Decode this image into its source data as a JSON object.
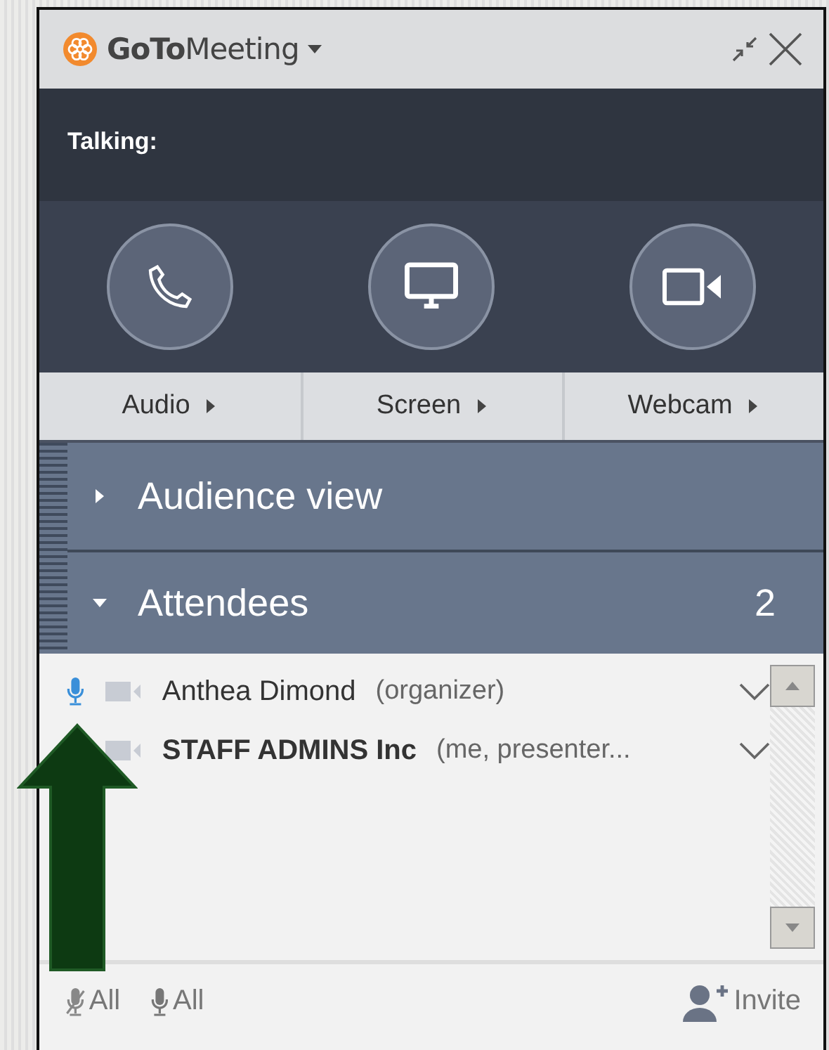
{
  "window": {
    "brand_bold": "GoTo",
    "brand_rest": "Meeting"
  },
  "talking": {
    "label": "Talking:"
  },
  "share_buttons": [
    {
      "kind": "audio",
      "label": "Audio"
    },
    {
      "kind": "screen",
      "label": "Screen"
    },
    {
      "kind": "webcam",
      "label": "Webcam"
    }
  ],
  "sections": [
    {
      "title": "Audience view",
      "expanded": false
    },
    {
      "title": "Attendees",
      "expanded": true,
      "count": "2"
    }
  ],
  "attendees": [
    {
      "name": "Anthea Dimond",
      "role": "(organizer)",
      "talking": true,
      "me": false
    },
    {
      "name": "STAFF ADMINS Inc",
      "role": "(me, presenter...",
      "me": true
    }
  ],
  "footer": {
    "mute_all": "All",
    "unmute_all": "All",
    "invite": "Invite"
  }
}
